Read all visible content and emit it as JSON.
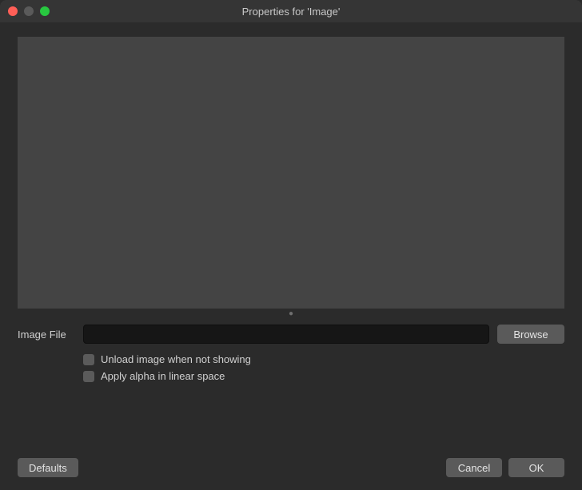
{
  "window": {
    "title": "Properties for 'Image'"
  },
  "fields": {
    "image_file_label": "Image File",
    "image_file_value": "",
    "browse_label": "Browse"
  },
  "checkboxes": {
    "unload_label": "Unload image when not showing",
    "unload_checked": false,
    "alpha_label": "Apply alpha in linear space",
    "alpha_checked": false
  },
  "buttons": {
    "defaults": "Defaults",
    "cancel": "Cancel",
    "ok": "OK"
  }
}
